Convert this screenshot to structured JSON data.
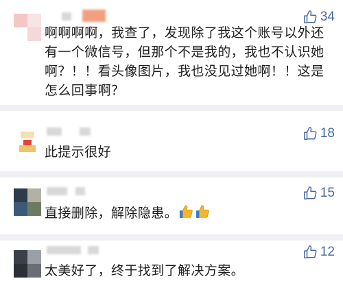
{
  "comments": [
    {
      "likes": "34",
      "text": "啊啊啊啊，我查了，发现除了我这个账号以外还有一个微信号，但那个不是我的，我也不认识她啊？！！看头像图片，我也没见过她啊！！这是怎么回事啊？",
      "avatar_colors": [
        "#f3c7c7",
        "#f7e4e4",
        "#f5d8d8",
        "#ffffff"
      ]
    },
    {
      "likes": "18",
      "text": "此提示很好",
      "avatar_colors": [
        "#f0c26a",
        "#e2453b",
        "#f6dfb5",
        "#ffffff"
      ]
    },
    {
      "likes": "15",
      "text": "直接删除，解除隐患。",
      "emojis": [
        "thumbs-up-emoji",
        "thumbs-up-emoji"
      ],
      "avatar_colors": [
        "#2e3b48",
        "#6c7a63",
        "#3b5a7a",
        "#b3b0a5"
      ]
    },
    {
      "likes": "12",
      "text": "太美好了，终于找到了解决方案。",
      "avatar_colors": [
        "#3a3f48",
        "#6b6e73",
        "#2b2f36",
        "#9aa0a6"
      ]
    }
  ],
  "like_icon": "thumbs-up-outline-icon",
  "colors": {
    "like_accent": "#4a6aa0",
    "divider": "#efeff4",
    "text": "#1f1f1f"
  }
}
